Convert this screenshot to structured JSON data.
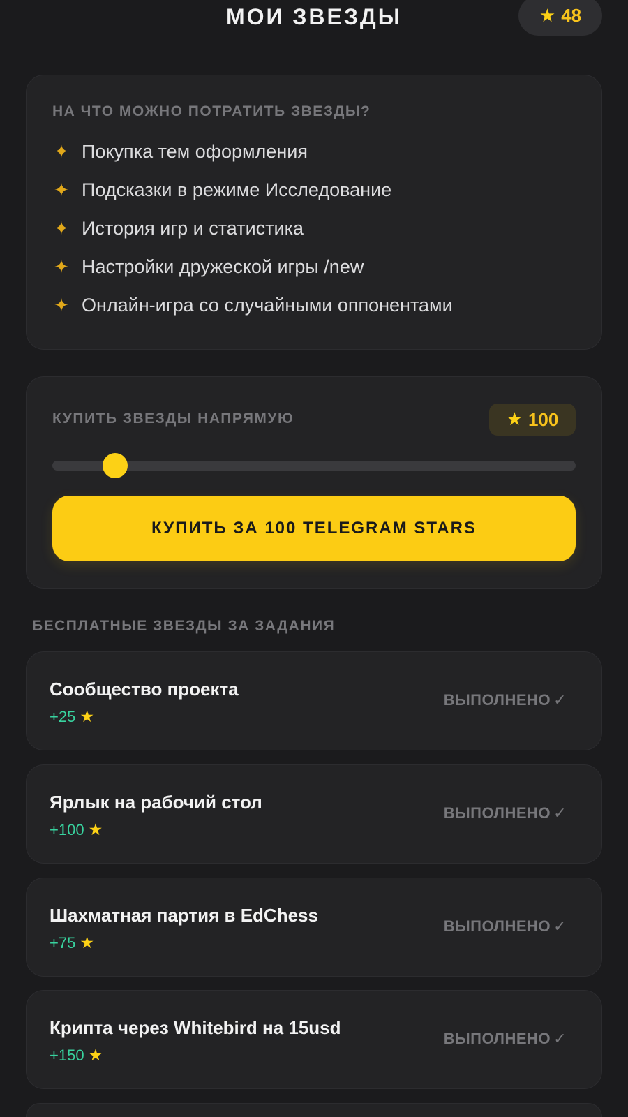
{
  "header": {
    "title": "МОИ ЗВЕЗДЫ",
    "balance": "48",
    "balance_icon": "star-icon"
  },
  "features": {
    "heading": "НА ЧТО МОЖНО ПОТРАТИТЬ ЗВЕЗДЫ?",
    "items": [
      "Покупка тем оформления",
      "Подсказки в режиме Исследование",
      "История игр и статистика",
      "Настройки дружеской игры /new",
      "Онлайн-игра со случайными оппонентами"
    ],
    "bullet_icon": "sparkle-icon"
  },
  "buy": {
    "heading": "КУПИТЬ ЗВЕЗДЫ НАПРЯМУЮ",
    "amount": "100",
    "slider_fraction": 0.12,
    "button_label": "КУПИТЬ ЗА 100 TELEGRAM STARS"
  },
  "tasks": {
    "heading": "БЕСПЛАТНЫЕ ЗВЕЗДЫ ЗА ЗАДАНИЯ",
    "items": [
      {
        "title": "Сообщество проекта",
        "reward": "+25",
        "status": "ВЫПОЛНЕНО"
      },
      {
        "title": "Ярлык на рабочий стол",
        "reward": "+100",
        "status": "ВЫПОЛНЕНО"
      },
      {
        "title": "Шахматная партия в EdChess",
        "reward": "+75",
        "status": "ВЫПОЛНЕНО"
      },
      {
        "title": "Крипта через Whitebird на 15usd",
        "reward": "+150",
        "status": "ВЫПОЛНЕНО"
      }
    ],
    "status_icon": "check-icon"
  },
  "colors": {
    "background": "#1b1b1d",
    "card": "#232325",
    "accent_yellow": "#fccc14",
    "reward_green": "#38d39f",
    "muted_text": "#77777b"
  }
}
